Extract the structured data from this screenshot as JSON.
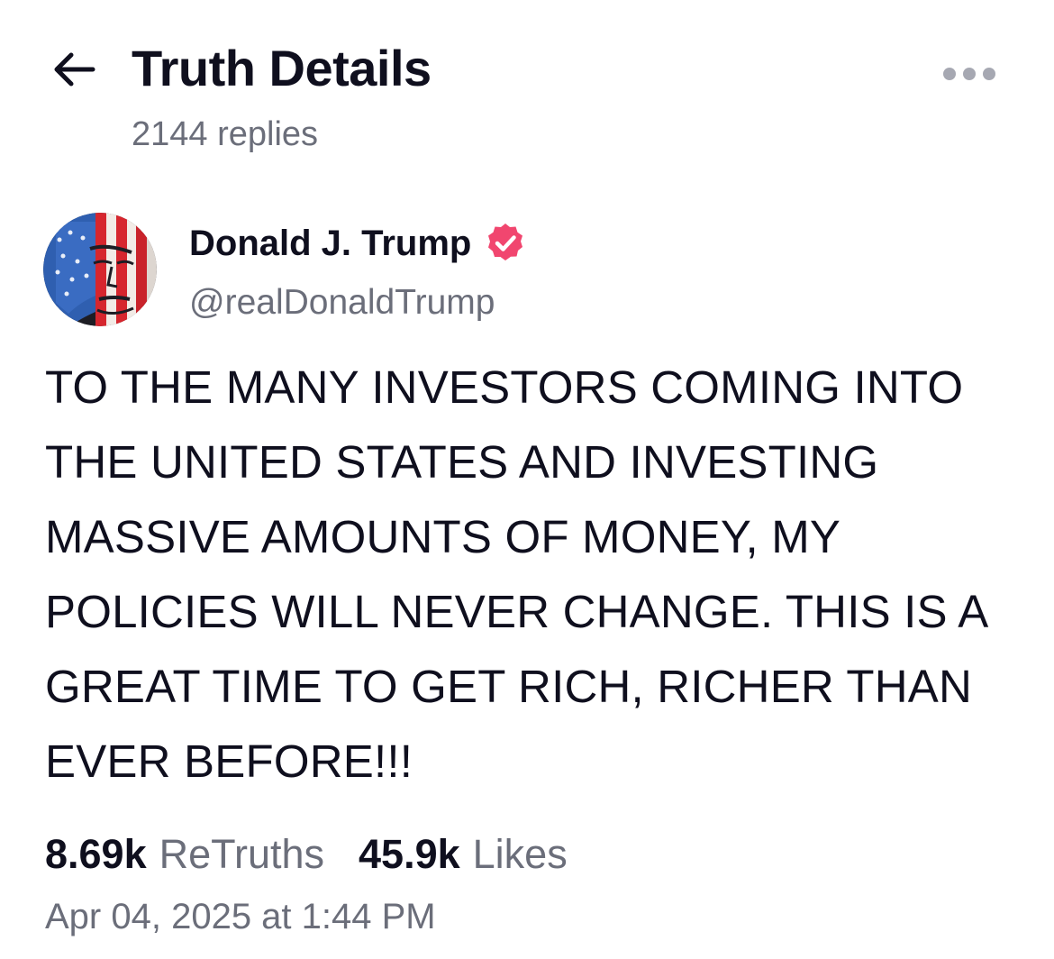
{
  "header": {
    "title": "Truth Details",
    "reply_count": "2144 replies",
    "back_icon": "arrow-left-icon",
    "more_icon": "more-horizontal-icon"
  },
  "post": {
    "author": {
      "name": "Donald J. Trump",
      "handle": "@realDonaldTrump",
      "verified": true,
      "verified_color": "#f1466f"
    },
    "body": "TO THE MANY INVESTORS COMING INTO THE UNITED STATES AND INVESTING MASSIVE AMOUNTS OF MONEY, MY POLICIES WILL NEVER CHANGE. THIS IS A GREAT TIME TO GET RICH, RICHER THAN EVER BEFORE!!!",
    "stats": {
      "retruths_count": "8.69k",
      "retruths_label": "ReTruths",
      "likes_count": "45.9k",
      "likes_label": "Likes"
    },
    "timestamp": "Apr 04, 2025 at 1:44 PM"
  },
  "colors": {
    "text_primary": "#0f0f1e",
    "text_secondary": "#6b6e7a",
    "icon_muted": "#a6a8b2",
    "accent": "#f1466f",
    "background": "#ffffff"
  }
}
